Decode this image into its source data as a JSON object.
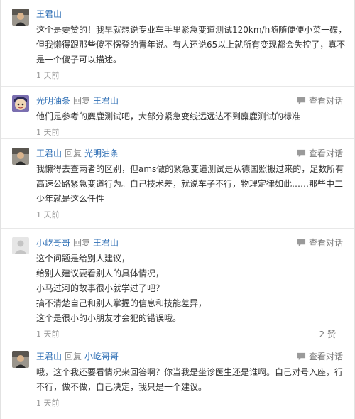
{
  "view_conversation_label": "查看对话",
  "reply_word": "回复",
  "comments": [
    {
      "author": "王君山",
      "reply_to": "",
      "lines": [
        "这个是要赞的！我早就想说专业车手里紧急变道测试120km/h随随便便小菜一碟，",
        "但我懒得跟那些傻不愣登的青年说。有人还说65以上就所有变现都会失控了，真不",
        "是一个傻子可以描述。"
      ],
      "time": "1 天前",
      "likes": ""
    },
    {
      "author": "光明油条",
      "reply_to": "王君山",
      "lines": [
        "他们是参考的麋鹿测试吧，大部分紧急变线远远达不到麋鹿测试的标准"
      ],
      "time": "1 天前",
      "likes": ""
    },
    {
      "author": "王君山",
      "reply_to": "光明油条",
      "lines": [
        "我懒得去查两者的区别，但ams做的紧急变道测试是从德国照搬过来的，足数所有",
        "高速公路紧急变道行为。自己技术差，就说车子不行，物理定律如此……那些中二",
        "少年就是这么任性"
      ],
      "time": "1 天前",
      "likes": ""
    },
    {
      "author": "小屹哥哥",
      "reply_to": "王君山",
      "lines": [
        "这个问题是给别人建议，",
        "给别人建议要看别人的具体情况，",
        "小马过河的故事很小就学过了吧？",
        "搞不清楚自己和别人掌握的信息和技能差异，",
        "这个是很小的小朋友才会犯的错误哦。"
      ],
      "time": "1 天前",
      "likes": "2 赞"
    },
    {
      "author": "王君山",
      "reply_to": "小屹哥哥",
      "lines": [
        "哦，这个我还要看情况来回答啊？你当我是坐诊医生还是谁啊。自己对号入座，行",
        "不行，做不做，自己决定，我只是一个建议。"
      ],
      "time": "1 天前",
      "likes": ""
    }
  ],
  "avatars": [
    "man-photo",
    "cartoon-face",
    "man-photo",
    "default-silhouette",
    "man-photo"
  ],
  "colors": {
    "link": "#2f6fb5",
    "text": "#333333",
    "meta": "#999999",
    "divider": "#e8e8e8"
  }
}
